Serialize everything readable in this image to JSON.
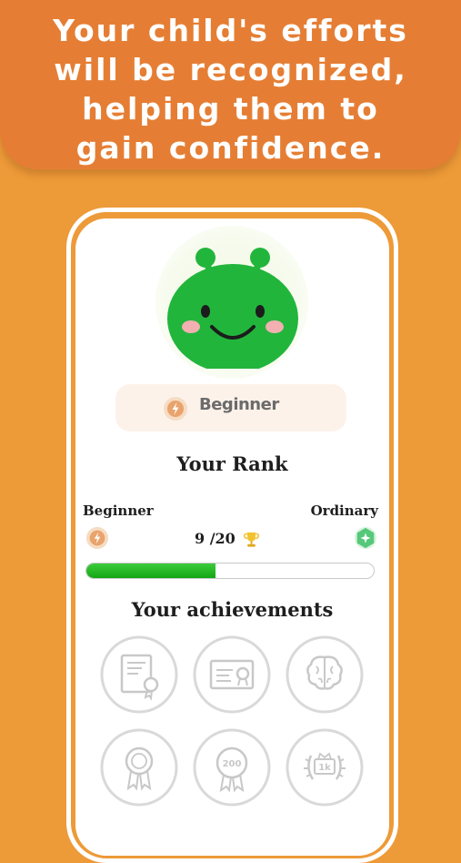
{
  "banner": {
    "text": "Your child's efforts\nwill be recognized,\nhelping them to\ngain confidence."
  },
  "profile": {
    "avatar": "green-alien-avatar",
    "level_label": "Beginner",
    "level_icon": "lightning-badge-icon"
  },
  "rank": {
    "title": "Your Rank",
    "current_label": "Beginner",
    "next_label": "Ordinary",
    "current_icon": "lightning-badge-icon",
    "next_icon": "star-gem-icon",
    "score_text": "9 /20",
    "score_icon": "trophy-icon",
    "progress_current": 9,
    "progress_total": 20
  },
  "achievements": {
    "title": "Your achievements",
    "badges": [
      {
        "name": "certificate-ribbon-icon",
        "state": "locked"
      },
      {
        "name": "diploma-seal-icon",
        "state": "locked"
      },
      {
        "name": "brain-icon",
        "state": "locked"
      },
      {
        "name": "medal-ribbon-icon",
        "state": "locked"
      },
      {
        "name": "medal-200-icon",
        "state": "locked"
      },
      {
        "name": "laurel-1k-icon",
        "state": "locked"
      }
    ]
  },
  "colors": {
    "background": "#ED9A38",
    "banner": "#E57E34",
    "progress": "#1DB31D",
    "avatar_green": "#22B53C"
  }
}
